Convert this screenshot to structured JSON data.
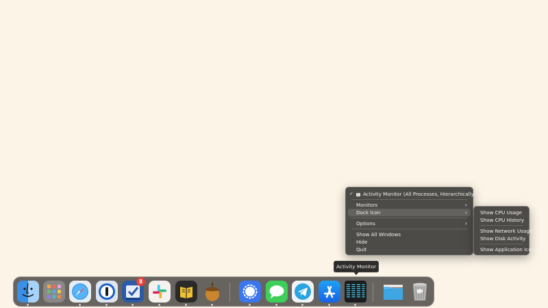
{
  "context_menu": {
    "app_item": "Activity Monitor (All Processes, Hierarchically)",
    "checkmark": "✓",
    "monitors": "Monitors",
    "dock_icon": "Dock Icon",
    "options": "Options",
    "show_all_windows": "Show All Windows",
    "hide": "Hide",
    "quit": "Quit",
    "arrow": "›"
  },
  "submenu": {
    "show_cpu_usage": "Show CPU Usage",
    "show_cpu_history": "Show CPU History",
    "show_network_usage": "Show Network Usage",
    "show_disk_activity": "Show Disk Activity",
    "show_application_icon": "Show Application Icon"
  },
  "tooltip": "Activity Monitor",
  "dock": {
    "badge_count": "8",
    "icons": [
      "finder-icon",
      "launchpad-icon",
      "safari-icon",
      "1password-icon",
      "omnifocus-icon",
      "slack-icon",
      "tes-icon",
      "acorn-icon",
      "signal-icon",
      "messages-icon",
      "telegram-icon",
      "app-store-icon",
      "activity-monitor-icon",
      "downloads-folder-icon",
      "trash-icon"
    ]
  },
  "colors": {
    "desktop": "#fcf4e6",
    "menu_bg": "#42403e",
    "highlight": "#64625f",
    "badge": "#e8413a"
  }
}
